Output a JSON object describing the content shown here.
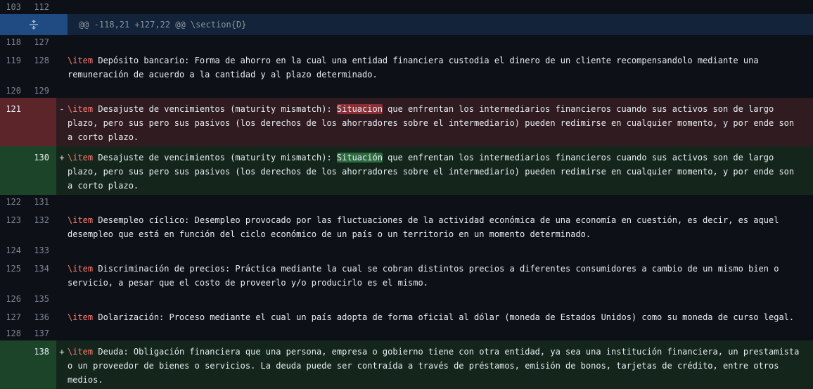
{
  "top_line": {
    "old": "103",
    "new": "112"
  },
  "hunk_header": "@@ -118,21 +127,22 @@ \\section{D}",
  "icons": {
    "expand": "expand-icon"
  },
  "rows": [
    {
      "type": "ctx",
      "old": "118",
      "new": "127",
      "text": ""
    },
    {
      "type": "ctx",
      "old": "119",
      "new": "128",
      "kw": "\\item",
      "text": " Depósito bancario: Forma de ahorro en la cual una entidad financiera custodia el dinero de un cliente recompensandolo mediante una remuneración de acuerdo a la cantidad y al plazo determinado."
    },
    {
      "type": "ctx",
      "old": "120",
      "new": "129",
      "text": ""
    },
    {
      "type": "del",
      "old": "121",
      "new": "",
      "sign": "-",
      "kw": "\\item",
      "pre": " Desajuste de vencimientos (maturity mismatch): ",
      "hl": "Situacion",
      "post": " que enfrentan los intermediarios financieros cuando sus activos son de largo plazo, pero sus pero sus pasivos (los derechos de los ahorradores sobre el intermediario) pueden redimirse en cualquier momento, y por ende son a corto plazo."
    },
    {
      "type": "add",
      "old": "",
      "new": "130",
      "sign": "+",
      "kw": "\\item",
      "pre": " Desajuste de vencimientos (maturity mismatch): ",
      "hl": "Situación",
      "post": " que enfrentan los intermediarios financieros cuando sus activos son de largo plazo, pero sus pero sus pasivos (los derechos de los ahorradores sobre el intermediario) pueden redimirse en cualquier momento, y por ende son a corto plazo."
    },
    {
      "type": "ctx",
      "old": "122",
      "new": "131",
      "text": ""
    },
    {
      "type": "ctx",
      "old": "123",
      "new": "132",
      "kw": "\\item",
      "text": " Desempleo cíclico: Desempleo provocado por las fluctuaciones de la actividad económica de una economía en cuestión, es decir, es aquel desempleo que está en función del ciclo económico de un país o un territorio en un momento determinado."
    },
    {
      "type": "ctx",
      "old": "124",
      "new": "133",
      "text": ""
    },
    {
      "type": "ctx",
      "old": "125",
      "new": "134",
      "kw": "\\item",
      "text": " Discriminación de precios: Práctica mediante la cual se cobran distintos precios a diferentes consumidores a cambio de un mismo bien o servicio, a pesar que el costo de proveerlo y/o producirlo es el mismo."
    },
    {
      "type": "ctx",
      "old": "126",
      "new": "135",
      "text": ""
    },
    {
      "type": "ctx",
      "old": "127",
      "new": "136",
      "kw": "\\item",
      "text": " Dolarización: Proceso mediante el cual un país adopta de forma oficial al dólar (moneda de Estados Unidos) como su moneda de curso legal."
    },
    {
      "type": "ctx",
      "old": "128",
      "new": "137",
      "text": ""
    },
    {
      "type": "add",
      "old": "",
      "new": "138",
      "sign": "+",
      "kw": "\\item",
      "pre": " Deuda: Obligación financiera que una persona, empresa o gobierno tiene con otra entidad, ya sea una institución financiera, un prestamista o un proveedor de bienes o servicios. La deuda puede ser contraída a través de préstamos, emisión de bonos, tarjetas de crédito, entre otros medios.",
      "hl": "",
      "post": ""
    }
  ]
}
